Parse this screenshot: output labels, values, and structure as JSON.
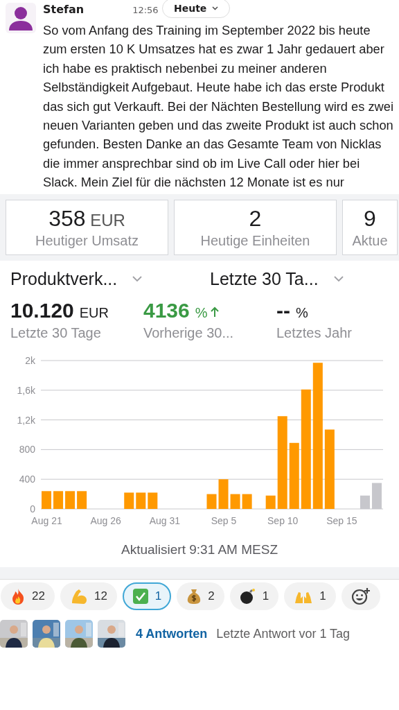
{
  "message": {
    "author": "Stefan",
    "time": "12:56",
    "date_pill": "Heute",
    "text": "So vom Anfang des Training im September 2022 bis heute zum ersten 10 K Umsatzes hat es zwar 1 Jahr gedauert aber ich habe es praktisch nebenbei zu meiner anderen Selbständigkeit Aufgebaut. Heute habe ich das erste Produkt das sich gut Verkauft. Bei der Nächten Bestellung wird es zwei neuen Varianten geben und das zweite Produkt ist auch schon gefunden. Besten Danke an das Gesamte Team von Nicklas die immer ansprechbar sind ob im Live Call oder hier bei Slack. Mein Ziel für die nächsten 12 Monate ist es nur"
  },
  "stat_cards": [
    {
      "value": "358",
      "unit": "EUR",
      "label": "Heutiger Umsatz"
    },
    {
      "value": "2",
      "label": "Heutige Einheiten"
    },
    {
      "value": "9",
      "label": "Aktue"
    }
  ],
  "dropdowns": [
    {
      "label": "Produktverk..."
    },
    {
      "label": "Letzte 30 Ta..."
    }
  ],
  "metrics": [
    {
      "value": "10.120",
      "unit": "EUR",
      "label": "Letzte 30 Tage",
      "kind": "plain"
    },
    {
      "value": "4136",
      "unit": "%",
      "label": "Vorherige 30...",
      "kind": "up"
    },
    {
      "value": "--",
      "unit": "%",
      "label": "Letztes Jahr",
      "kind": "plain"
    }
  ],
  "chart": {
    "chart_data": {
      "type": "bar",
      "categories": [
        "Aug 21",
        null,
        null,
        null,
        null,
        "Aug 26",
        null,
        null,
        null,
        null,
        "Aug 31",
        null,
        null,
        null,
        null,
        "Sep 5",
        null,
        null,
        null,
        null,
        "Sep 10",
        null,
        null,
        null,
        null,
        "Sep 15",
        null,
        null,
        null
      ],
      "grid": true,
      "series": [
        {
          "color": "#ff9900",
          "values": [
            240,
            240,
            240,
            240,
            null,
            null,
            null,
            220,
            220,
            220,
            null,
            null,
            null,
            null,
            200,
            400,
            200,
            200,
            null,
            180,
            1250,
            890,
            1610,
            1970,
            1070,
            null,
            null,
            null,
            null
          ]
        },
        {
          "color": "#c7c7cc",
          "values": [
            null,
            null,
            null,
            null,
            null,
            null,
            null,
            null,
            null,
            null,
            null,
            null,
            null,
            null,
            null,
            null,
            null,
            null,
            null,
            null,
            null,
            null,
            null,
            null,
            null,
            null,
            null,
            180,
            350
          ]
        }
      ],
      "ylim": [
        0,
        2000
      ],
      "yticks": [
        0,
        {
          "value": 400,
          "label": "400"
        },
        {
          "value": 800,
          "label": "800"
        },
        {
          "value": 1200,
          "label": "1,2k"
        },
        {
          "value": 1600,
          "label": "1,6k"
        },
        {
          "value": 2000,
          "label": "2k"
        }
      ]
    },
    "updated": "Aktualisiert 9:31 AM MESZ"
  },
  "reactions": [
    {
      "kind": "fire",
      "count": "22",
      "selected": false
    },
    {
      "kind": "muscle",
      "count": "12",
      "selected": false
    },
    {
      "kind": "check",
      "count": "1",
      "selected": true
    },
    {
      "kind": "moneybag",
      "count": "2",
      "selected": false
    },
    {
      "kind": "bomb",
      "count": "1",
      "selected": false
    },
    {
      "kind": "hands",
      "count": "1",
      "selected": false
    },
    {
      "kind": "add"
    }
  ],
  "replies": {
    "count_link": "4 Antworten",
    "last_reply": "Letzte Antwort vor 1 Tag"
  }
}
